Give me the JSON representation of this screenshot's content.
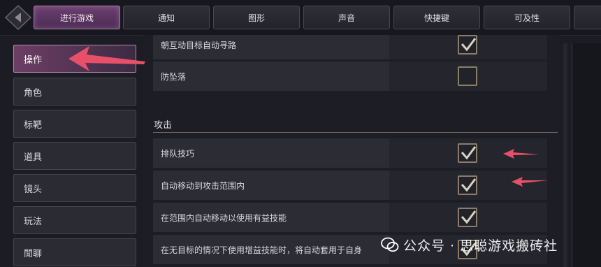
{
  "tabs": [
    {
      "label": "进行游戏",
      "active": true
    },
    {
      "label": "通知",
      "active": false
    },
    {
      "label": "图形",
      "active": false
    },
    {
      "label": "声音",
      "active": false
    },
    {
      "label": "快捷键",
      "active": false
    },
    {
      "label": "可及性",
      "active": false
    }
  ],
  "sidebar": {
    "items": [
      {
        "label": "操作",
        "active": true
      },
      {
        "label": "角色"
      },
      {
        "label": "标靶"
      },
      {
        "label": "道具"
      },
      {
        "label": "镜头"
      },
      {
        "label": "玩法"
      },
      {
        "label": "閒聊"
      }
    ]
  },
  "content": {
    "rows_top": [
      {
        "label": "朝互动目标自动寻路",
        "checked": true
      },
      {
        "label": "防坠落",
        "checked": false
      }
    ],
    "section_title": "攻击",
    "rows_attack": [
      {
        "label": "排队技巧",
        "checked": true
      },
      {
        "label": "自动移动到攻击范围内",
        "checked": true
      },
      {
        "label": "在范围内自动移动以使用有益技能",
        "checked": true
      },
      {
        "label": "在无目标的情况下使用增益技能时，将自动套用于自身",
        "checked": true
      }
    ]
  },
  "watermark": "公众号 · 思聪游戏搬砖社",
  "colors": {
    "accent": "#6d3e66",
    "arrow": "#e8506a",
    "checkmark": "#d9d3c6"
  }
}
